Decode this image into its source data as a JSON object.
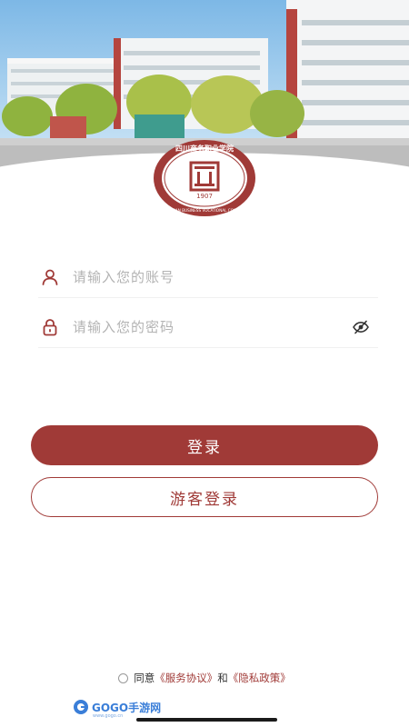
{
  "emblem": {
    "top_text": "四川商务职业学院",
    "bottom_text": "SICHUAN BUSINESS VOCATIONAL COLLEGE",
    "year": "1907"
  },
  "login": {
    "account_placeholder": "请输入您的账号",
    "password_placeholder": "请输入您的密码",
    "login_button": "登录",
    "guest_button": "游客登录"
  },
  "agreement": {
    "prefix": "同意",
    "service": "《服务协议》",
    "and": "和",
    "privacy": "《隐私政策》"
  },
  "watermark": {
    "brand": "GOGO手游网",
    "url": "www.gogo.cn"
  },
  "colors": {
    "primary": "#a03a37",
    "placeholder": "#b3b3b3"
  },
  "icons": {
    "account": "user-icon",
    "password": "lock-icon",
    "visibility": "eye-off-icon"
  }
}
